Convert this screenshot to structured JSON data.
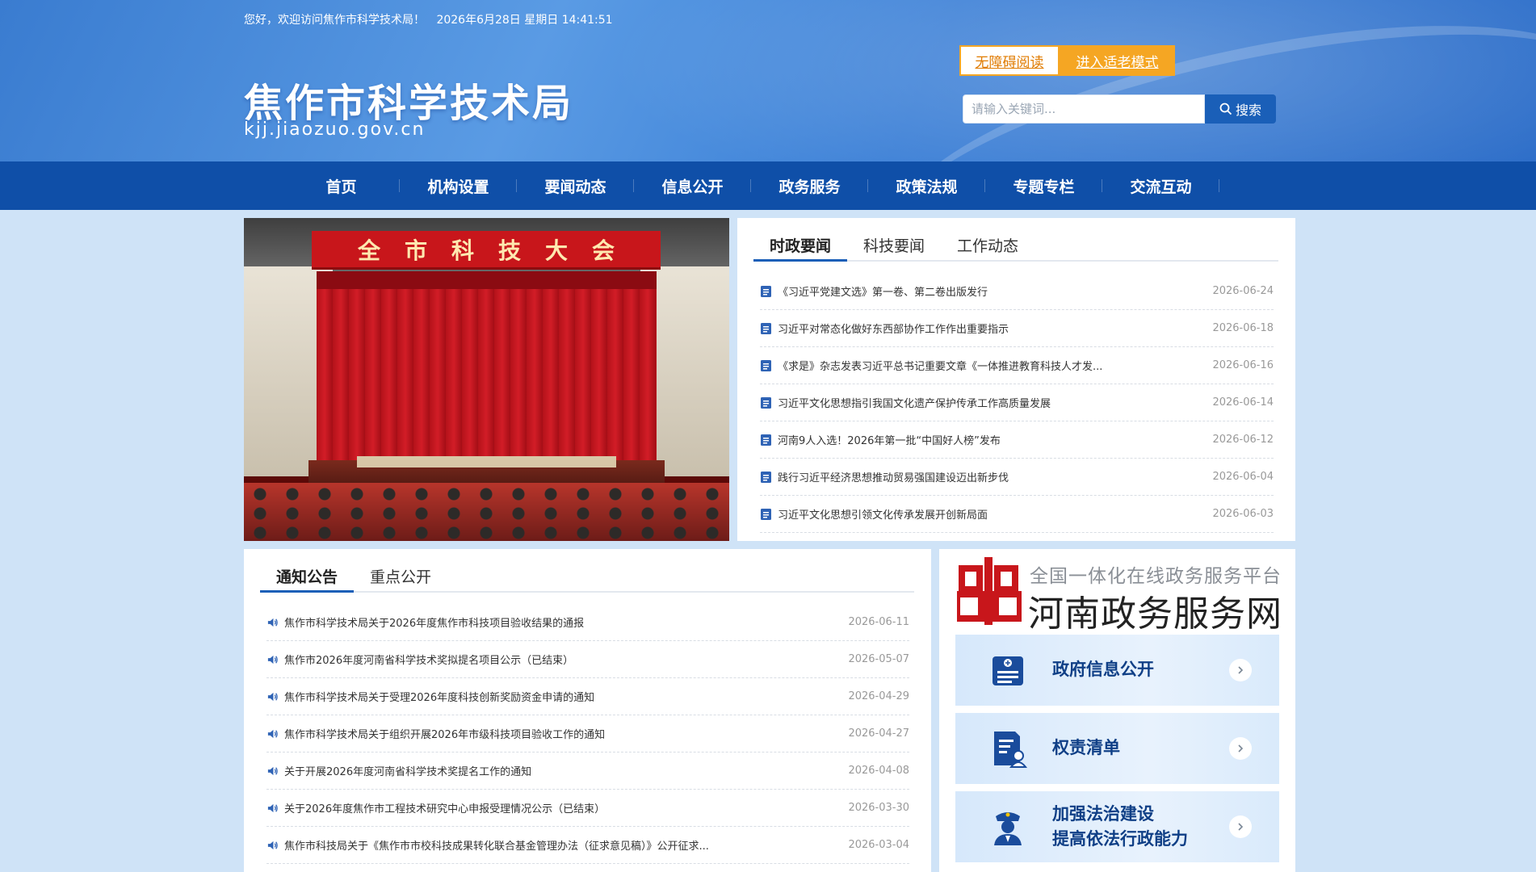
{
  "header": {
    "greeting": "您好，欢迎访问焦作市科学技术局！",
    "datetime": "2026年6月28日 星期日 14:41:51",
    "site_title": "焦作市科学技术局",
    "site_domain": "kjj.jiaozuo.gov.cn",
    "btn_accessible": "无障碍阅读",
    "btn_elder": "进入适老模式",
    "search_placeholder": "请输入关键词...",
    "search_button": "搜索"
  },
  "nav": {
    "items": [
      "首页",
      "机构设置",
      "要闻动态",
      "信息公开",
      "政务服务",
      "政策法规",
      "专题专栏",
      "交流互动"
    ]
  },
  "banner": {
    "sign_text": "全市科技大会"
  },
  "news": {
    "tabs": [
      "时政要闻",
      "科技要闻",
      "工作动态"
    ],
    "active_tab": "时政要闻",
    "items": [
      {
        "title": "《习近平党建文选》第一卷、第二卷出版发行",
        "date": "2026-06-24"
      },
      {
        "title": "习近平对常态化做好东西部协作工作作出重要指示",
        "date": "2026-06-18"
      },
      {
        "title": "《求是》杂志发表习近平总书记重要文章《一体推进教育科技人才发...",
        "date": "2026-06-16"
      },
      {
        "title": "习近平文化思想指引我国文化遗产保护传承工作高质量发展",
        "date": "2026-06-14"
      },
      {
        "title": "河南9人入选！2026年第一批“中国好人榜”发布",
        "date": "2026-06-12"
      },
      {
        "title": "践行习近平经济思想推动贸易强国建设迈出新步伐",
        "date": "2026-06-04"
      },
      {
        "title": "习近平文化思想引领文化传承发展开创新局面",
        "date": "2026-06-03"
      }
    ]
  },
  "notices": {
    "tabs": [
      "通知公告",
      "重点公开"
    ],
    "active_tab": "通知公告",
    "items": [
      {
        "title": "焦作市科学技术局关于2026年度焦作市科技项目验收结果的通报",
        "date": "2026-06-11"
      },
      {
        "title": "焦作市2026年度河南省科学技术奖拟提名项目公示（已结束）",
        "date": "2026-05-07"
      },
      {
        "title": "焦作市科学技术局关于受理2026年度科技创新奖励资金申请的通知",
        "date": "2026-04-29"
      },
      {
        "title": "焦作市科学技术局关于组织开展2026年市级科技项目验收工作的通知",
        "date": "2026-04-27"
      },
      {
        "title": "关于开展2026年度河南省科学技术奖提名工作的通知",
        "date": "2026-04-08"
      },
      {
        "title": "关于2026年度焦作市工程技术研究中心申报受理情况公示（已结束）",
        "date": "2026-03-30"
      },
      {
        "title": "焦作市科技局关于《焦作市市校科技成果转化联合基金管理办法（征求意见稿）》公开征求...",
        "date": "2026-03-04"
      }
    ]
  },
  "services": {
    "platform_sub": "全国一体化在线政务服务平台",
    "platform_name": "河南政务服务网",
    "cards": [
      {
        "label": "政府信息公开",
        "icon": "document-id-icon"
      },
      {
        "label": "权责清单",
        "icon": "user-list-icon"
      },
      {
        "label_line1": "加强法治建设",
        "label_line2": "提高依法行政能力",
        "icon": "police-officer-icon"
      }
    ]
  },
  "colors": {
    "nav_bg": "#0f4fa8",
    "accent": "#1a5fb8",
    "orange": "#f5a623",
    "page_bg": "#cfe3f7"
  }
}
